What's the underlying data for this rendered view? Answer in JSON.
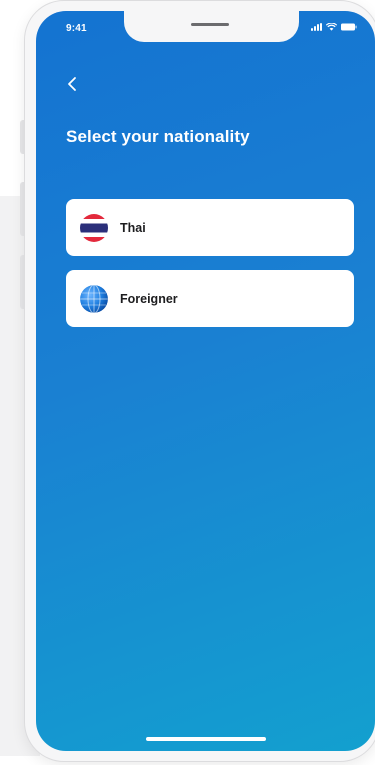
{
  "status_bar": {
    "time": "9:41",
    "icons": [
      "signal-icon",
      "wifi-icon",
      "battery-icon"
    ]
  },
  "header": {
    "back_icon": "chevron-left-icon",
    "title": "Select your nationality"
  },
  "options": [
    {
      "label": "Thai",
      "icon": "thailand-flag-icon"
    },
    {
      "label": "Foreigner",
      "icon": "globe-icon"
    }
  ],
  "colors": {
    "background_start": "#1473d1",
    "background_end": "#13a0cf",
    "card": "#ffffff",
    "text_on_card": "#1d1d1f",
    "flag_red": "#e3293c",
    "flag_blue": "#2b2f7a",
    "globe_blue": "#1f7fe0"
  }
}
